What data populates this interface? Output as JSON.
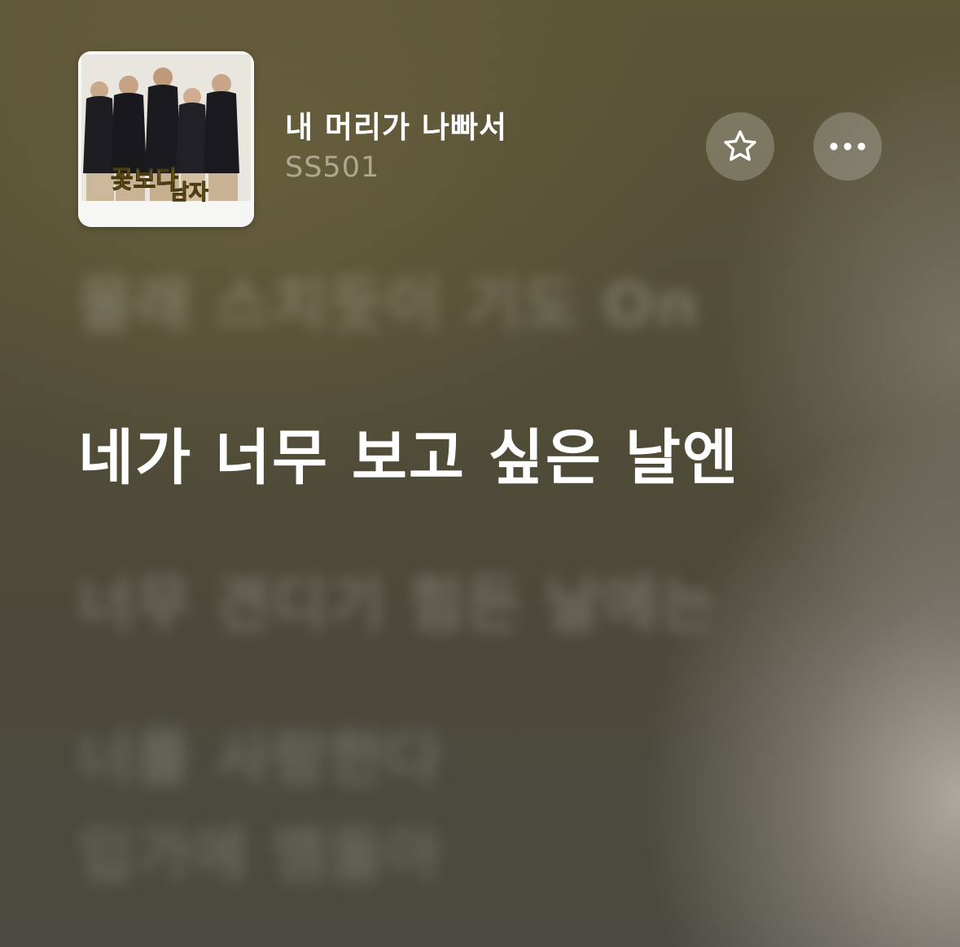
{
  "now_playing": {
    "title": "내 머리가 나빠서",
    "artist": "SS501",
    "artwork_icon": "album-artwork"
  },
  "controls": {
    "favorite_icon": "star-icon",
    "more_icon": "ellipsis-icon"
  },
  "lyrics": {
    "previous": "몰래 스치듯이 기도 On",
    "current": "네가 너무 보고 싶은 날엔",
    "next": "너무 견디기 힘든 날에는",
    "upcoming": [
      "너를 사랑한다",
      "입가에 맴돌아"
    ]
  },
  "colors": {
    "current_lyric": "#ffffff",
    "dim_lyric": "rgba(255,255,255,0.22)",
    "artist": "rgba(235,230,215,0.55)",
    "button_bg": "rgba(255,255,255,0.22)"
  }
}
